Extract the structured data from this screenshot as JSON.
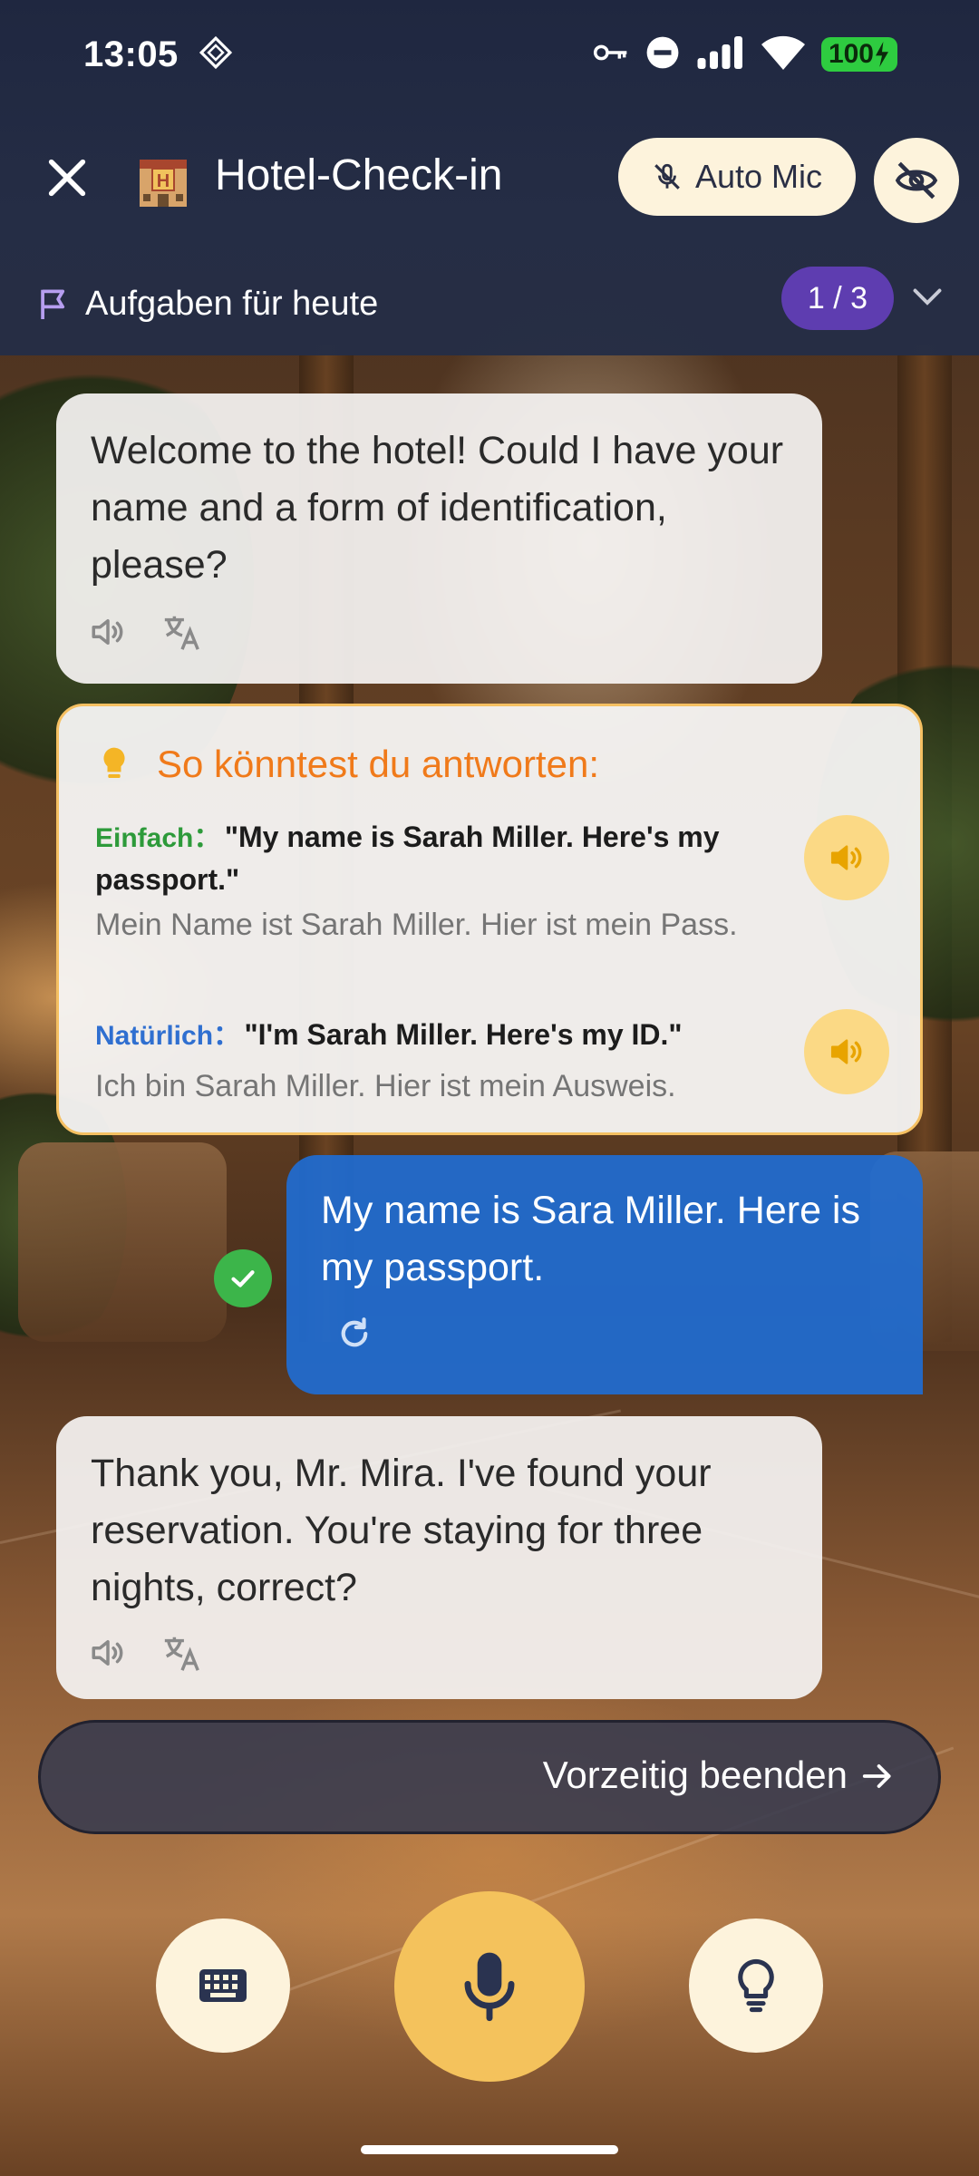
{
  "status_bar": {
    "time": "13:05",
    "battery": "100",
    "icons": [
      "diamond-outline-icon",
      "key-icon",
      "do-not-disturb-icon",
      "signal-icon",
      "wifi-icon",
      "battery-charging-icon"
    ]
  },
  "header": {
    "title": "Hotel-Check-in",
    "auto_mic_label": "Auto Mic",
    "icons": [
      "close-icon",
      "hotel-icon",
      "mic-off-icon",
      "eye-off-icon"
    ]
  },
  "tasks": {
    "label": "Aufgaben für heute",
    "progress": "1 / 3"
  },
  "chat": {
    "ai_message_1": "Welcome to the hotel! Could I have your name and a form of identification, please?",
    "hint": {
      "title": "So könntest du antworten:",
      "simple_label": "Einfach",
      "simple_text": "\"My name is Sarah Miller. Here's my passport.\"",
      "simple_translation": "Mein Name ist Sarah Miller. Hier ist mein Pass.",
      "natural_label": "Natürlich",
      "natural_text": "\"I'm Sarah Miller. Here's my ID.\"",
      "natural_translation": "Ich bin Sarah Miller. Hier ist mein Ausweis."
    },
    "user_message": "My name is Sara Miller. Here is my passport.",
    "ai_message_2": "Thank you, Mr. Mira. I've found your reservation. You're staying for three nights, correct?"
  },
  "actions": {
    "end_early_label": "Vorzeitig beenden",
    "colon": "："
  },
  "colors": {
    "header_bg": "#252d45",
    "accent_yellow": "#f4c25c",
    "cream": "#fdf3dc",
    "user_bubble": "#206cd2",
    "hint_orange": "#f07a1a",
    "progress_purple": "#5e3db0"
  }
}
